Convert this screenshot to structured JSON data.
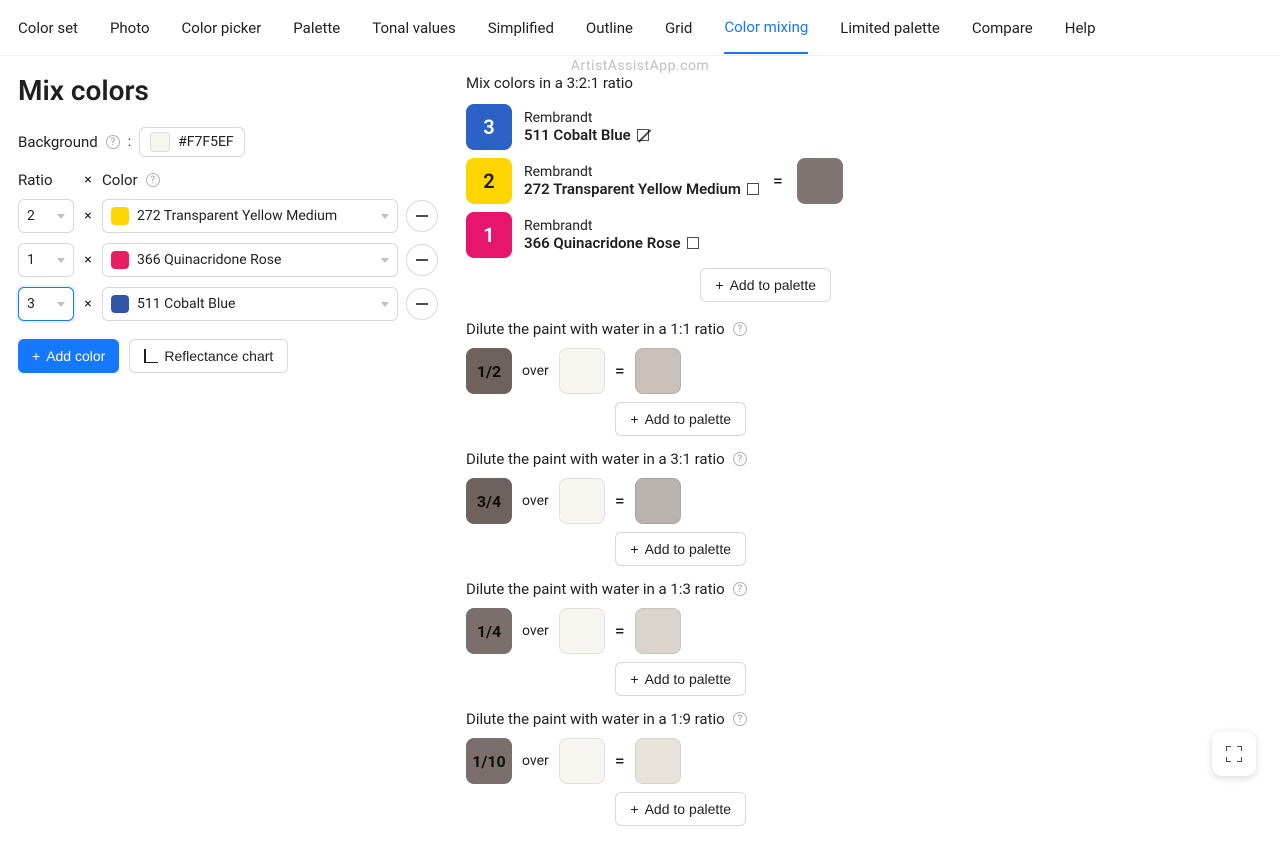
{
  "watermark": "ArtistAssistApp.com",
  "tabs": [
    "Color set",
    "Photo",
    "Color picker",
    "Palette",
    "Tonal values",
    "Simplified",
    "Outline",
    "Grid",
    "Color mixing",
    "Limited palette",
    "Compare",
    "Help"
  ],
  "active_tab": 8,
  "page_title": "Mix colors",
  "left": {
    "background_label": "Background",
    "background_hex": "#F7F5EF",
    "ratio_header": "Ratio",
    "x_header": "×",
    "color_header": "Color",
    "rows": [
      {
        "ratio": "2",
        "swatch": "#FFD500",
        "name": "272 Transparent Yellow Medium",
        "active": false
      },
      {
        "ratio": "1",
        "swatch": "#E91E63",
        "name": "366 Quinacridone Rose",
        "active": false
      },
      {
        "ratio": "3",
        "swatch": "#3355A5",
        "name": "511 Cobalt Blue",
        "active": true
      }
    ],
    "add_color_label": "Add color",
    "reflectance_label": "Reflectance chart"
  },
  "right": {
    "mix_title": "Mix colors in a 3:2:1 ratio",
    "paints": [
      {
        "ratio": "3",
        "chip_color": "#2C62C5",
        "dark_text": false,
        "brand": "Rembrandt",
        "name": "511 Cobalt Blue",
        "diag": true
      },
      {
        "ratio": "2",
        "chip_color": "#FFD500",
        "dark_text": true,
        "brand": "Rembrandt",
        "name": "272 Transparent Yellow Medium",
        "diag": false
      },
      {
        "ratio": "1",
        "chip_color": "#E5166B",
        "dark_text": false,
        "brand": "Rembrandt",
        "name": "366 Quinacridone Rose",
        "diag": false
      }
    ],
    "equals": "=",
    "result_color": "#7F7572",
    "add_to_palette": "Add to palette",
    "over_text": "over",
    "dilutions": [
      {
        "title": "Dilute the paint with water in a 1:1 ratio",
        "frac": "1/2",
        "frac_bg": "#6E625F",
        "bg": "#F7F5EF",
        "result": "#C8C0B9"
      },
      {
        "title": "Dilute the paint with water in a 3:1 ratio",
        "frac": "3/4",
        "frac_bg": "#6E625F",
        "bg": "#F7F5EF",
        "result": "#BAB2AC"
      },
      {
        "title": "Dilute the paint with water in a 1:3 ratio",
        "frac": "1/4",
        "frac_bg": "#7A6F6C",
        "bg": "#F7F5EF",
        "result": "#DAD5CC"
      },
      {
        "title": "Dilute the paint with water in a 1:9 ratio",
        "frac": "1/10",
        "frac_bg": "#7A6F6C",
        "bg": "#F7F5EF",
        "result": "#E8E4DB"
      }
    ]
  }
}
